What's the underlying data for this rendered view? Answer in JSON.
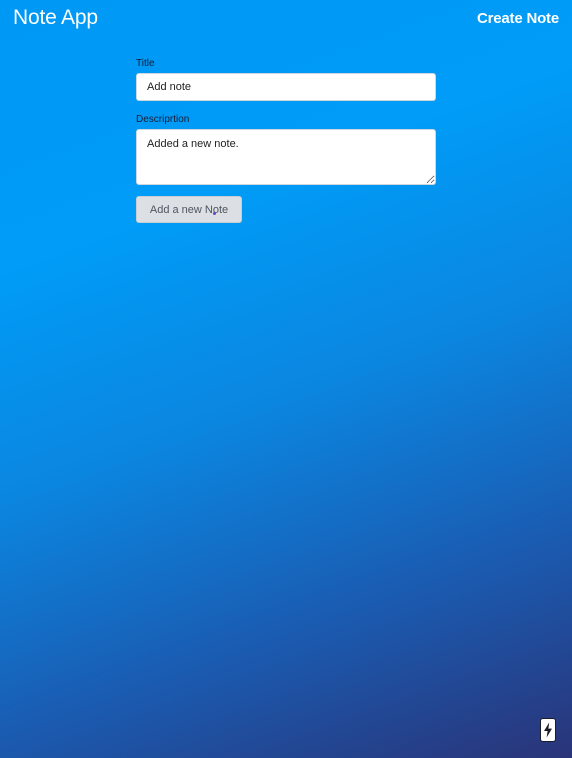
{
  "header": {
    "brand": "Note App",
    "nav_link": "Create Note"
  },
  "form": {
    "title": {
      "label": "Title",
      "value": "Add note"
    },
    "description": {
      "label": "Descriprtion",
      "value": "Added a new note."
    },
    "submit_label": "Add a new Note"
  },
  "icons": {
    "corner_badge": "lightning-bolt-icon"
  },
  "colors": {
    "gradient_start": "#0098f5",
    "gradient_end": "#2a3478",
    "button_bg": "#dcdfe3"
  }
}
